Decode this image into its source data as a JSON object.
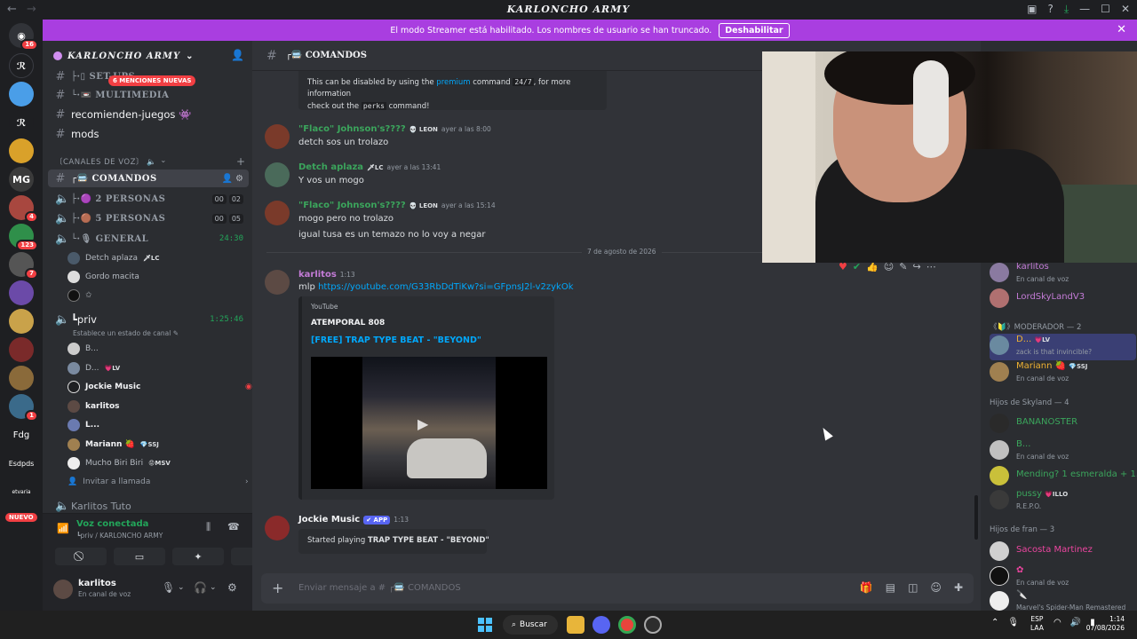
{
  "window": {
    "title": "KARLONCHO ARMY"
  },
  "banner": {
    "text": "El modo Streamer está habilitado. Los nombres de usuario se han truncado.",
    "button": "Deshabilitar"
  },
  "rail": {
    "badges": [
      "16",
      "4",
      "8",
      "123",
      "7",
      "1"
    ],
    "text_servers": [
      "Fdg",
      "Esdpds",
      "etvaria"
    ],
    "nuevo": "NUEVO"
  },
  "sidebar": {
    "guild_name": "KARLONCHO ARMY",
    "mentions_pill": "6 MENCIONES NUEVAS",
    "channels": [
      {
        "prefix": "#",
        "name": "├·▯ SET-UPS"
      },
      {
        "prefix": "#",
        "name": "└·📼 MULTIMEDIA"
      },
      {
        "prefix": "#",
        "name": "recomienden-juegos 👾"
      },
      {
        "prefix": "#",
        "name": "mods"
      }
    ],
    "voice_category": "〔CANALES DE VOZ〕 🔈",
    "active_channel": "┌🚍 COMANDOS",
    "voice_channels": [
      {
        "name": "├·🟣 2 PERSONAS",
        "a": "00",
        "b": "02"
      },
      {
        "name": "├·🟤 5 PERSONAS",
        "a": "00",
        "b": "05"
      },
      {
        "name": "└·🎙 GENERAL",
        "timer": "24:30"
      }
    ],
    "general_users": [
      {
        "name": "Detch aplaza",
        "tag": "🗡LC"
      },
      {
        "name": "Gordo macita"
      },
      {
        "name": "✩"
      }
    ],
    "priv": {
      "name": "┗priv",
      "timer": "1:25:46",
      "status_prompt": "Establece un estado de canal ✎"
    },
    "priv_users": [
      {
        "name": "B..."
      },
      {
        "name": "D...",
        "tag": "💗LV"
      },
      {
        "name": "Jockie Music"
      },
      {
        "name": "karlitos"
      },
      {
        "name": "L..."
      },
      {
        "name": "Mariann 🍓",
        "tag": "💎SSJ"
      },
      {
        "name": "Mucho Biri Biri",
        "tag": "😡MSV"
      }
    ],
    "invite": "Invitar a llamada",
    "next_channel": "Karlitos Tuto"
  },
  "voice_panel": {
    "status": "Voz conectada",
    "location": "┗priv / KARLONCHO ARMY"
  },
  "user_panel": {
    "name": "karlitos",
    "status": "En canal de voz"
  },
  "chat": {
    "channel": "┌🚍 COMANDOS",
    "embed_top": {
      "pre": "This can be disabled by using the",
      "premium": "premium",
      "mid": "command",
      "code1": "24/7",
      "post": ", for more information",
      "line2": "check out the",
      "code2": "perks",
      "end": "command!"
    },
    "messages": [
      {
        "author": "\"Flaco\" Johnson's????",
        "tag": "💀 LEON",
        "time": "ayer a las 8:00",
        "lines": [
          "detch sos un trolazo"
        ]
      },
      {
        "author": "Detch aplaza",
        "tag": "🗡LC",
        "time": "ayer a las 13:41",
        "lines": [
          "Y vos un mogo"
        ]
      },
      {
        "author": "\"Flaco\" Johnson's????",
        "tag": "💀 LEON",
        "time": "ayer a las 15:14",
        "lines": [
          "mogo pero no trolazo",
          "igual tusa es un temazo no lo voy a negar"
        ]
      }
    ],
    "date_divider": "7 de agosto de 2026",
    "link_msg": {
      "author": "karlitos",
      "time": "1:13",
      "prefix": "mlp",
      "url": "https://youtube.com/G33RbDdTiKw?si=GFpnsJ2l-v2zykOk"
    },
    "youtube": {
      "provider": "YouTube",
      "author": "ATEMPORAL 808",
      "title": "[FREE] TRAP TYPE BEAT - \"BEYOND\""
    },
    "bot_msg": {
      "author": "Jockie Music",
      "app": "✔ APP",
      "time": "1:13",
      "pre": "Started playing",
      "song": "TRAP TYPE BEAT - \"BEYOND\""
    },
    "composer_placeholder": "Enviar mensaje a # ┌🚍 COMANDOS"
  },
  "members": {
    "top": [
      {
        "name": "karlitos",
        "status": "En canal de voz",
        "color": "#c37bd6"
      },
      {
        "name": "LordSkyLandV3",
        "color": "#c37bd6"
      }
    ],
    "moderador_header": "《🔰》MODERADOR — 2",
    "moderadores": [
      {
        "name": "D...",
        "tag": "💗LV",
        "status": "zack is that invincible?",
        "color": "#f0b232"
      },
      {
        "name": "Mariann 🍓",
        "tag": "💎SSJ",
        "status": "En canal de voz",
        "color": "#f0b232"
      }
    ],
    "skyland_header": "Hijos de Skyland — 4",
    "skyland": [
      {
        "name": "BANANOSTER",
        "color": "#3ba55c"
      },
      {
        "name": "B...",
        "status": "En canal de voz",
        "color": "#3ba55c"
      },
      {
        "name": "Mending? 1 esmeralda + 1...",
        "color": "#3ba55c"
      },
      {
        "name": "pussy",
        "tag": "💗ILLO",
        "status": "R.E.P.O.",
        "color": "#3ba55c"
      }
    ],
    "fran_header": "Hijos de fran — 3",
    "fran": [
      {
        "name": "Sacosta Martinez",
        "color": "#eb459f"
      },
      {
        "name": "✿",
        "status": "En canal de voz",
        "color": "#eb459f"
      },
      {
        "name": "🔪",
        "status": "Marvel's Spider-Man Remastered",
        "color": "#eb459f"
      }
    ]
  },
  "taskbar": {
    "search": "Buscar",
    "lang1": "ESP",
    "lang2": "LAA",
    "time": "1:14",
    "date": "07/08/2026"
  },
  "colors": {
    "accent": "#5865f2",
    "banner": "#a93ee0",
    "online": "#23a55a",
    "link": "#00a8fc"
  }
}
